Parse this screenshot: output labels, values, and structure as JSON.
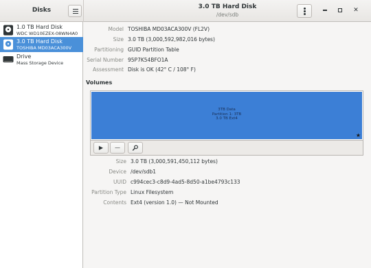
{
  "header": {
    "app_title": "Disks",
    "window_title": "3.0 TB Hard Disk",
    "window_subtitle": "/dev/sdb"
  },
  "sidebar": {
    "items": [
      {
        "title": "1.0 TB Hard Disk",
        "subtitle": "WDC WD10EZEX-08WN4A0",
        "icon": "hard-disk-icon",
        "selected": false
      },
      {
        "title": "3.0 TB Hard Disk",
        "subtitle": "TOSHIBA MD03ACA300V",
        "icon": "hard-disk-icon",
        "selected": true
      },
      {
        "title": "Drive",
        "subtitle": "Mass Storage Device",
        "icon": "removable-drive-icon",
        "selected": false
      }
    ]
  },
  "disk_properties": [
    {
      "label": "Model",
      "value": "TOSHIBA MD03ACA300V (FL2V)"
    },
    {
      "label": "Size",
      "value": "3.0 TB (3,000,592,982,016 bytes)"
    },
    {
      "label": "Partitioning",
      "value": "GUID Partition Table"
    },
    {
      "label": "Serial Number",
      "value": "95P7K54BFO1A"
    },
    {
      "label": "Assessment",
      "value": "Disk is OK (42° C / 108° F)"
    }
  ],
  "volumes": {
    "heading": "Volumes",
    "partition_label_lines": [
      "3TB Data",
      "Partition 1: 3TB",
      "3.0 TB Ext4"
    ],
    "partition_color": "#3c7fd6"
  },
  "partition_properties": [
    {
      "label": "Size",
      "value": "3.0 TB (3,000,591,450,112 bytes)"
    },
    {
      "label": "Device",
      "value": "/dev/sdb1"
    },
    {
      "label": "UUID",
      "value": "c994cec3-c8d9-4ad5-8d50-a1be4793c133"
    },
    {
      "label": "Partition Type",
      "value": "Linux Filesystem"
    },
    {
      "label": "Contents",
      "value": "Ext4 (version 1.0) — Not Mounted"
    }
  ],
  "colors": {
    "selection": "#4a90d9",
    "partition_bar": "#3c7fd6"
  }
}
